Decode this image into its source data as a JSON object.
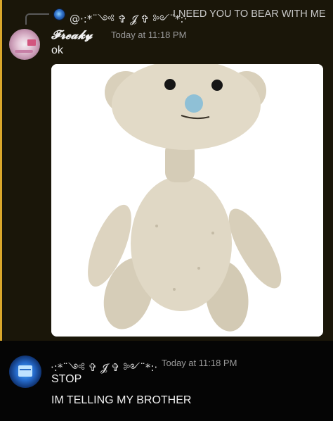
{
  "reply": {
    "author": "@·:*¨༺ ✞ 𝓙 ✞ ༻¨*:·",
    "text": "I NEED YOU TO BEAR WITH ME"
  },
  "message1": {
    "author": "𝓕𝓻𝓮𝓪𝓴𝔂",
    "timestamp": "Today at 11:18 PM",
    "text": "ok",
    "attachment": "teddy-bear-image"
  },
  "message2": {
    "author": "·:*¨༺ ✞ 𝓙 ✞ ༻¨*:·",
    "timestamp": "Today at 11:18 PM",
    "lines": [
      "STOP",
      "IM TELLING MY BROTHER"
    ]
  },
  "colors": {
    "background": "#050505",
    "mention_highlight": "#1a1609",
    "mention_bar": "#d9a72b"
  }
}
